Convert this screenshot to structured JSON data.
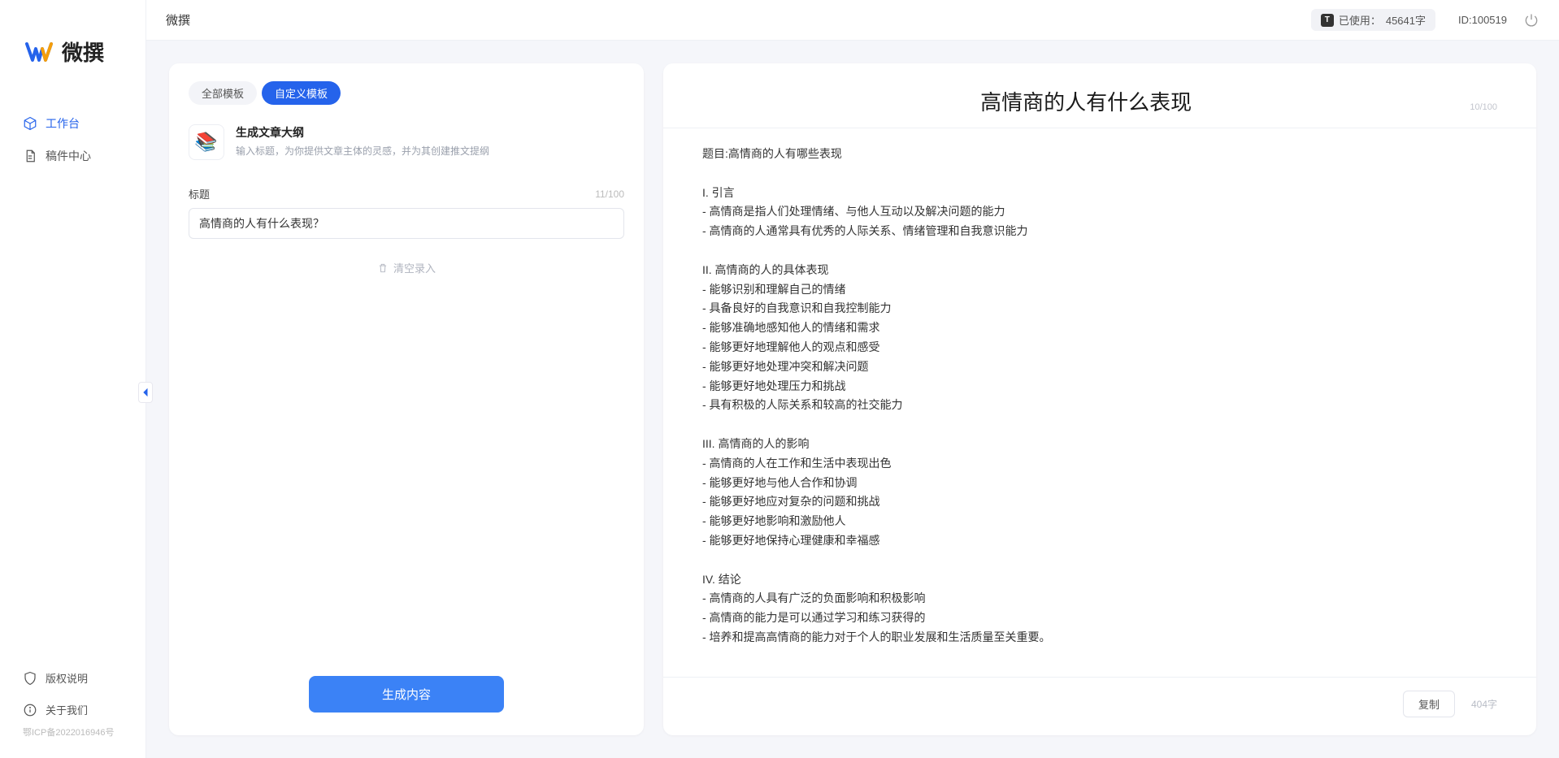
{
  "brand": {
    "name": "微撰"
  },
  "sidebar": {
    "nav": [
      {
        "label": "工作台",
        "icon": "cube"
      },
      {
        "label": "稿件中心",
        "icon": "document"
      }
    ],
    "footer": [
      {
        "label": "版权说明",
        "icon": "shield"
      },
      {
        "label": "关于我们",
        "icon": "info"
      }
    ],
    "icp": "鄂ICP备2022016946号"
  },
  "topbar": {
    "title": "微撰",
    "usage_prefix": "已使用：",
    "usage_value": "45641字",
    "user_id_label": "ID:100519"
  },
  "left_panel": {
    "tabs": [
      {
        "label": "全部模板",
        "active": false
      },
      {
        "label": "自定义模板",
        "active": true
      }
    ],
    "template": {
      "title": "生成文章大纲",
      "desc": "输入标题，为你提供文章主体的灵感，并为其创建推文提纲"
    },
    "field_label": "标题",
    "field_counter": "11/100",
    "input_value": "高情商的人有什么表现？",
    "clear_label": "清空录入",
    "generate_label": "生成内容"
  },
  "right_panel": {
    "title": "高情商的人有什么表现",
    "title_counter": "10/100",
    "body": "题目:高情商的人有哪些表现\n\nI. 引言\n- 高情商是指人们处理情绪、与他人互动以及解决问题的能力\n- 高情商的人通常具有优秀的人际关系、情绪管理和自我意识能力\n\nII. 高情商的人的具体表现\n- 能够识别和理解自己的情绪\n- 具备良好的自我意识和自我控制能力\n- 能够准确地感知他人的情绪和需求\n- 能够更好地理解他人的观点和感受\n- 能够更好地处理冲突和解决问题\n- 能够更好地处理压力和挑战\n- 具有积极的人际关系和较高的社交能力\n\nIII. 高情商的人的影响\n- 高情商的人在工作和生活中表现出色\n- 能够更好地与他人合作和协调\n- 能够更好地应对复杂的问题和挑战\n- 能够更好地影响和激励他人\n- 能够更好地保持心理健康和幸福感\n\nIV. 结论\n- 高情商的人具有广泛的负面影响和积极影响\n- 高情商的能力是可以通过学习和练习获得的\n- 培养和提高高情商的能力对于个人的职业发展和生活质量至关重要。",
    "copy_label": "复制",
    "char_count": "404字"
  }
}
